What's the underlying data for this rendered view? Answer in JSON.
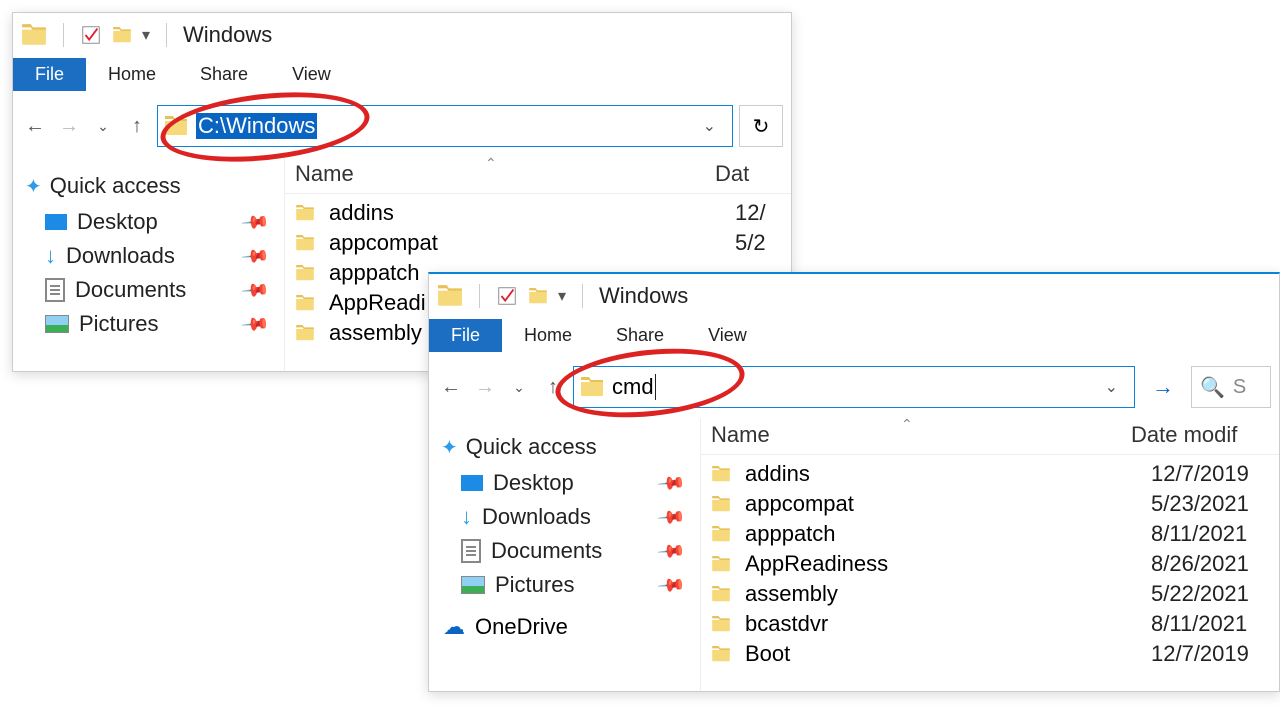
{
  "windows": [
    {
      "title": "Windows",
      "address_value": "C:\\Windows",
      "tabs": {
        "file": "File",
        "home": "Home",
        "share": "Share",
        "view": "View"
      },
      "columns": {
        "name": "Name",
        "date": "Dat"
      },
      "quick_access": {
        "label": "Quick access",
        "items": [
          {
            "label": "Desktop"
          },
          {
            "label": "Downloads"
          },
          {
            "label": "Documents"
          },
          {
            "label": "Pictures"
          }
        ]
      },
      "rows": [
        {
          "name": "addins",
          "date": "12/"
        },
        {
          "name": "appcompat",
          "date": "5/2"
        },
        {
          "name": "apppatch",
          "date": ""
        },
        {
          "name": "AppReadi",
          "date": ""
        },
        {
          "name": "assembly",
          "date": ""
        }
      ]
    },
    {
      "title": "Windows",
      "address_value": "cmd",
      "search_placeholder": "S",
      "tabs": {
        "file": "File",
        "home": "Home",
        "share": "Share",
        "view": "View"
      },
      "columns": {
        "name": "Name",
        "date": "Date modif"
      },
      "quick_access": {
        "label": "Quick access",
        "items": [
          {
            "label": "Desktop"
          },
          {
            "label": "Downloads"
          },
          {
            "label": "Documents"
          },
          {
            "label": "Pictures"
          }
        ]
      },
      "onedrive": "OneDrive",
      "rows": [
        {
          "name": "addins",
          "date": "12/7/2019"
        },
        {
          "name": "appcompat",
          "date": "5/23/2021"
        },
        {
          "name": "apppatch",
          "date": "8/11/2021"
        },
        {
          "name": "AppReadiness",
          "date": "8/26/2021"
        },
        {
          "name": "assembly",
          "date": "5/22/2021"
        },
        {
          "name": "bcastdvr",
          "date": "8/11/2021"
        },
        {
          "name": "Boot",
          "date": "12/7/2019"
        }
      ]
    }
  ]
}
